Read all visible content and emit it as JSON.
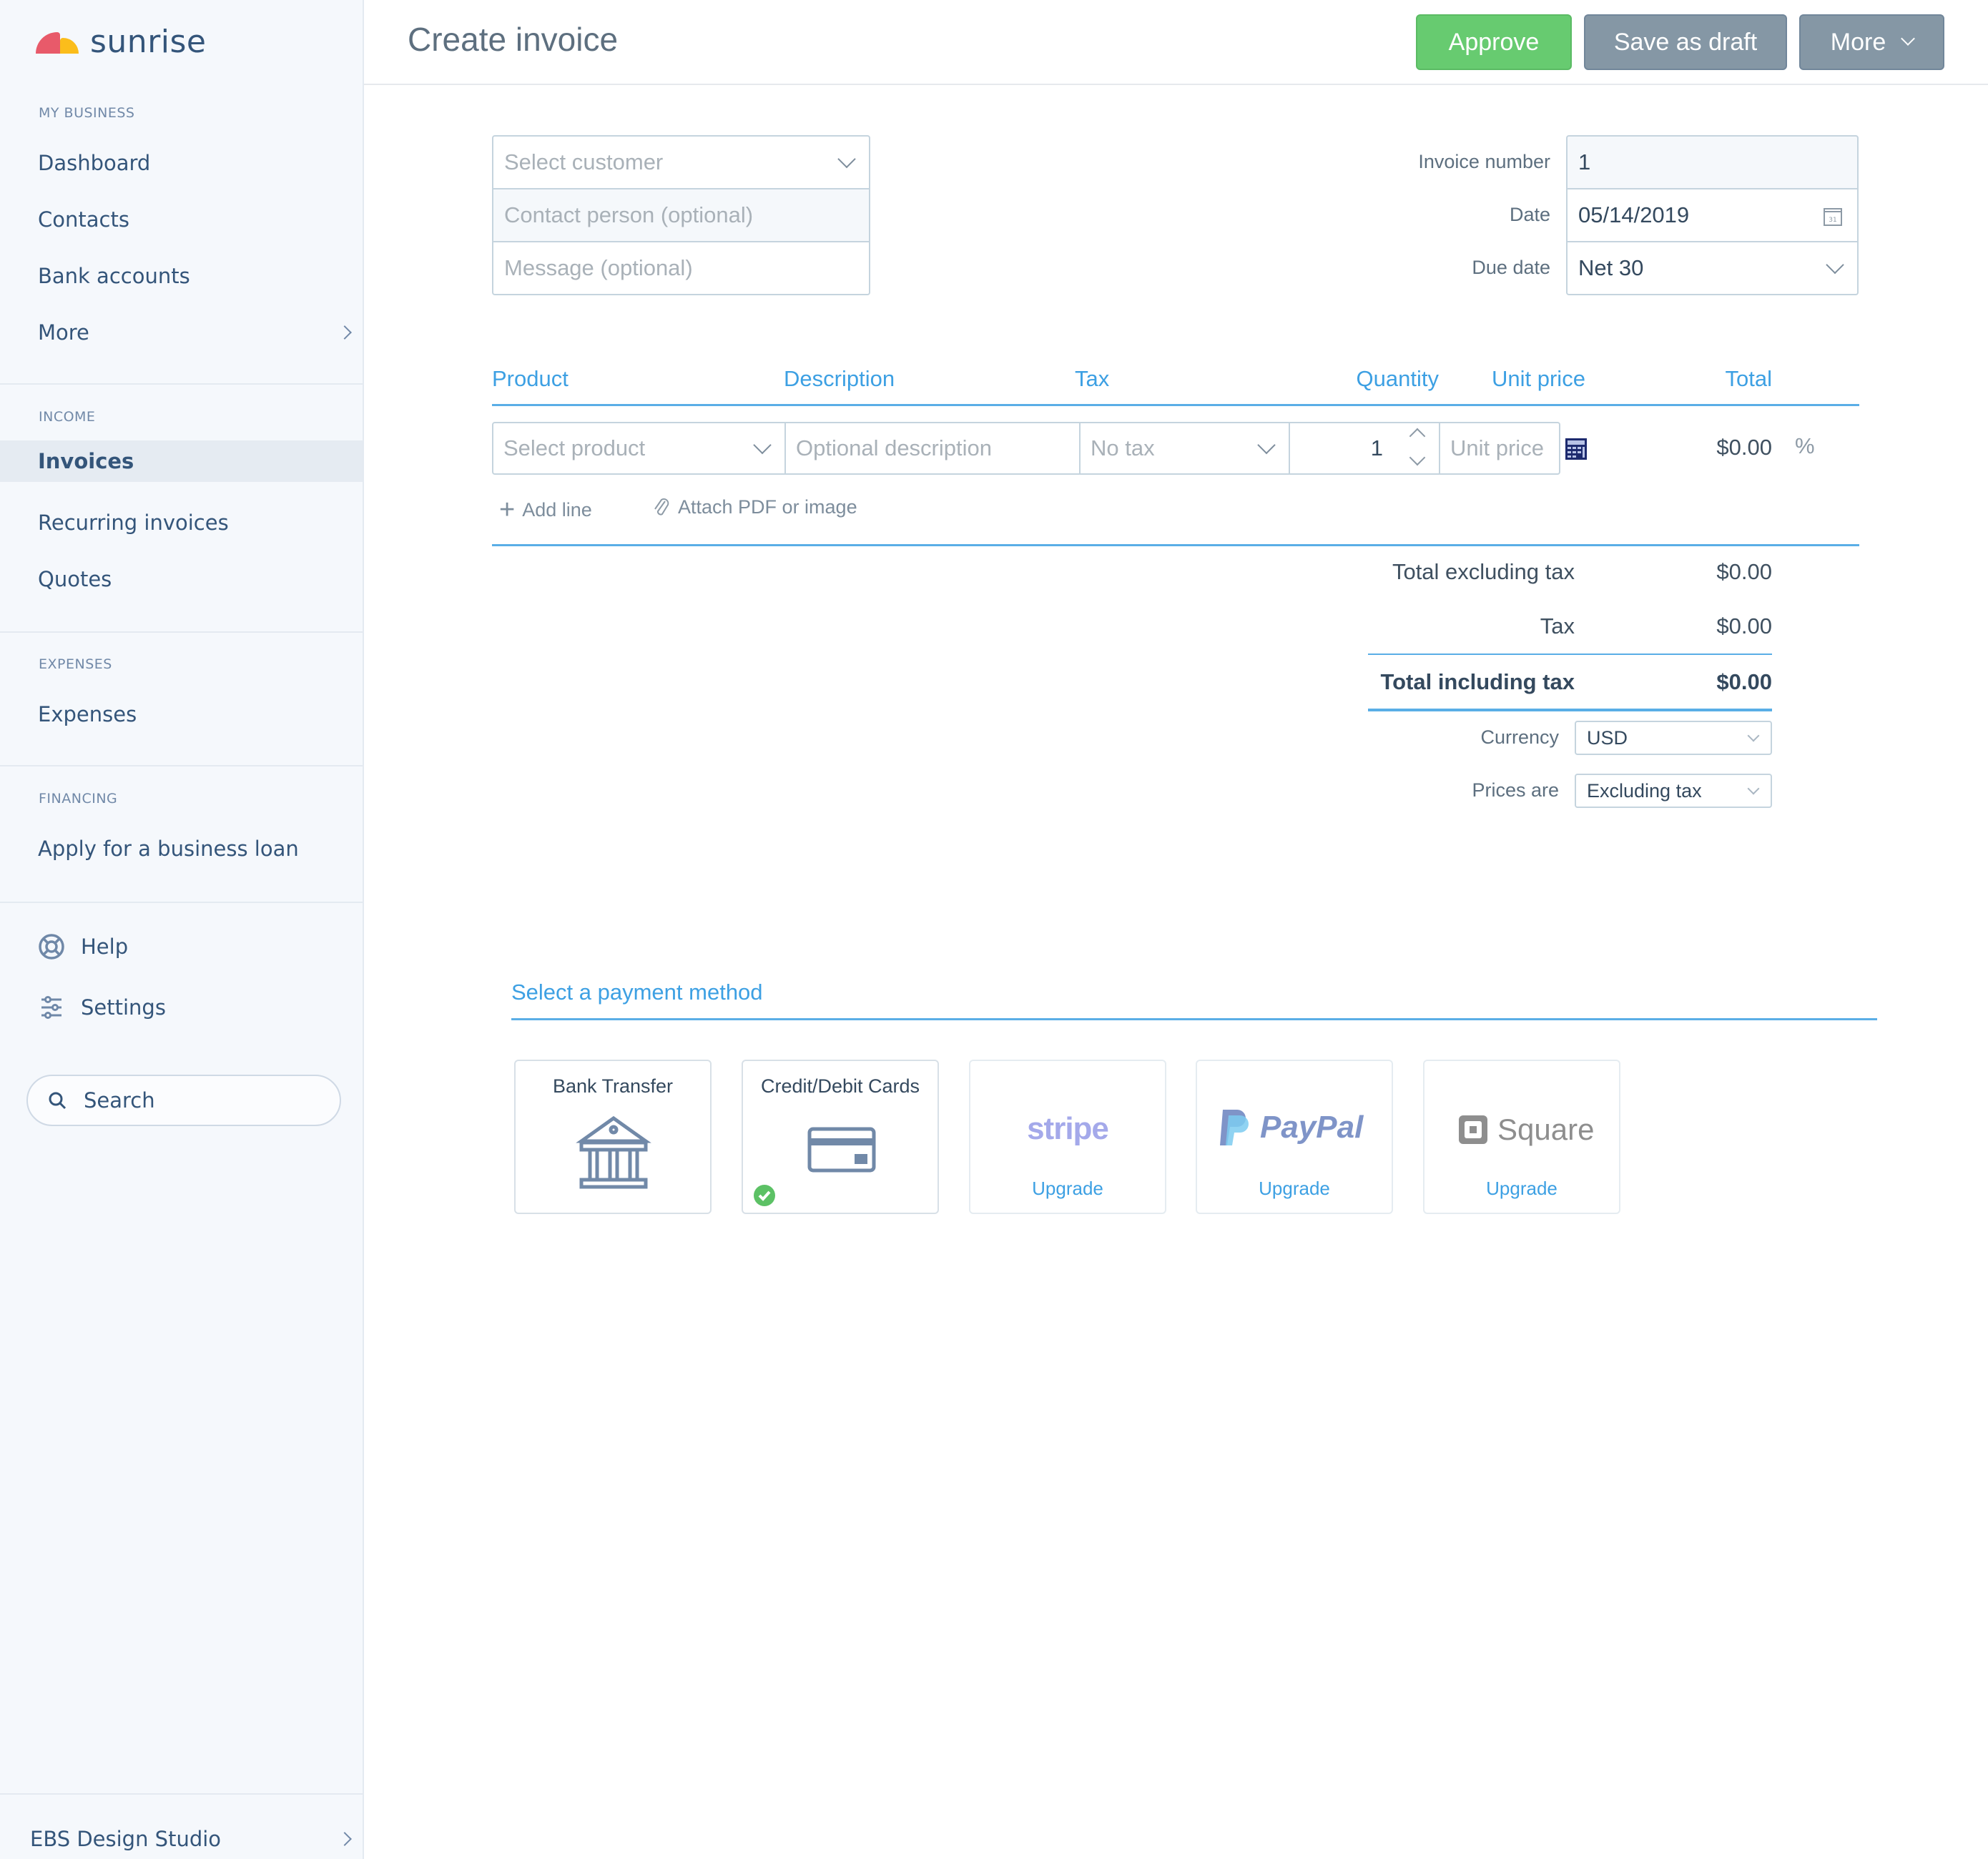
{
  "app": {
    "brand": "sunrise"
  },
  "sidebar": {
    "sections": [
      {
        "label": "MY BUSINESS",
        "items": [
          "Dashboard",
          "Contacts",
          "Bank accounts",
          "More"
        ]
      },
      {
        "label": "INCOME",
        "items": [
          "Invoices",
          "Recurring invoices",
          "Quotes"
        ]
      },
      {
        "label": "EXPENSES",
        "items": [
          "Expenses"
        ]
      },
      {
        "label": "FINANCING",
        "items": [
          "Apply for a business loan"
        ]
      }
    ],
    "active_item": "Invoices",
    "help": "Help",
    "settings": "Settings",
    "search_placeholder": "Search",
    "company": "EBS Design Studio"
  },
  "header": {
    "title": "Create invoice",
    "approve": "Approve",
    "save_draft": "Save as draft",
    "more": "More"
  },
  "customer": {
    "select_placeholder": "Select customer",
    "contact_placeholder": "Contact person (optional)",
    "message_placeholder": "Message (optional)"
  },
  "meta": {
    "invoice_number_label": "Invoice number",
    "invoice_number": "1",
    "date_label": "Date",
    "date": "05/14/2019",
    "due_label": "Due date",
    "due": "Net 30"
  },
  "lines": {
    "columns": [
      "Product",
      "Description",
      "Tax",
      "Quantity",
      "Unit price",
      "Total"
    ],
    "row": {
      "product_placeholder": "Select product",
      "description_placeholder": "Optional description",
      "tax": "No tax",
      "quantity": "1",
      "unit_price_placeholder": "Unit price",
      "total": "$0.00",
      "discount_symbol": "%"
    },
    "add_line": "Add line",
    "attach": "Attach PDF or image"
  },
  "totals": {
    "excl_label": "Total excluding tax",
    "excl": "$0.00",
    "tax_label": "Tax",
    "tax": "$0.00",
    "incl_label": "Total including tax",
    "incl": "$0.00",
    "currency_label": "Currency",
    "currency": "USD",
    "prices_label": "Prices are",
    "prices": "Excluding tax"
  },
  "payment": {
    "title": "Select a payment method",
    "methods": [
      {
        "name": "Bank Transfer",
        "enabled": false
      },
      {
        "name": "Credit/Debit Cards",
        "enabled": true
      },
      {
        "name": "stripe",
        "action": "Upgrade"
      },
      {
        "name": "PayPal",
        "action": "Upgrade"
      },
      {
        "name": "Square",
        "action": "Upgrade"
      }
    ]
  },
  "colors": {
    "accent": "#3da0e3",
    "approve": "#67cb70",
    "secondary_button": "#8597a5",
    "sidebar_bg": "#f5f8fc",
    "active_bg": "#e5ebf2"
  }
}
